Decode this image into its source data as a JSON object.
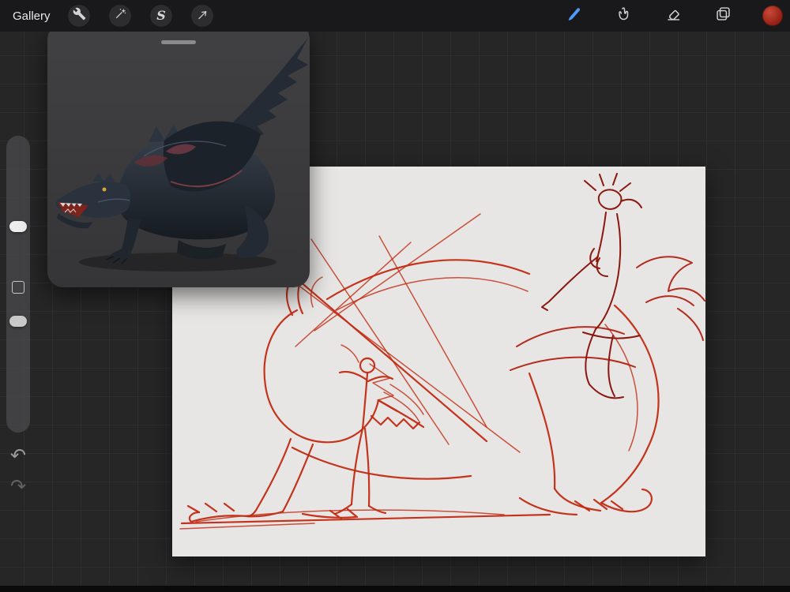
{
  "app": {
    "name": "Procreate painting canvas"
  },
  "topbar": {
    "gallery_label": "Gallery",
    "left_tools": [
      {
        "id": "actions",
        "icon": "wrench-icon"
      },
      {
        "id": "adjustments",
        "icon": "magic-wand-icon"
      },
      {
        "id": "selection",
        "icon": "selection-s-icon",
        "glyph": "S"
      },
      {
        "id": "transform",
        "icon": "transform-arrow-icon"
      }
    ],
    "right_tools": [
      {
        "id": "paint",
        "icon": "paintbrush-icon",
        "active": true
      },
      {
        "id": "smudge",
        "icon": "smudge-finger-icon",
        "active": false
      },
      {
        "id": "erase",
        "icon": "eraser-icon",
        "active": false
      },
      {
        "id": "layers",
        "icon": "layers-icon",
        "active": false
      },
      {
        "id": "color",
        "icon": "color-swatch",
        "active": false
      }
    ],
    "active_tool_color": "#4f9bf8",
    "icon_color": "#d6d6d6",
    "current_color": "#a81f12"
  },
  "sidebar": {
    "sliders": [
      {
        "id": "brush-size",
        "knob_color": "#ededed"
      },
      {
        "id": "opacity",
        "knob_color": "#c9c9c9"
      }
    ],
    "modify_button": {
      "id": "modify"
    },
    "undo_glyph": "↶",
    "redo_glyph": "↷"
  },
  "reference_panel": {
    "content": "dragon reference image",
    "has_drag_handle": true
  },
  "canvas": {
    "background_color": "#e7e6e4",
    "sketch": {
      "primary_stroke_color": "#c22a12",
      "secondary_stroke_color": "#8c1710",
      "description": "rough red sketch of a crouching dragon with a rider figure"
    }
  },
  "background": {
    "base_color": "#262626",
    "grid_color": "#2e2e30"
  }
}
